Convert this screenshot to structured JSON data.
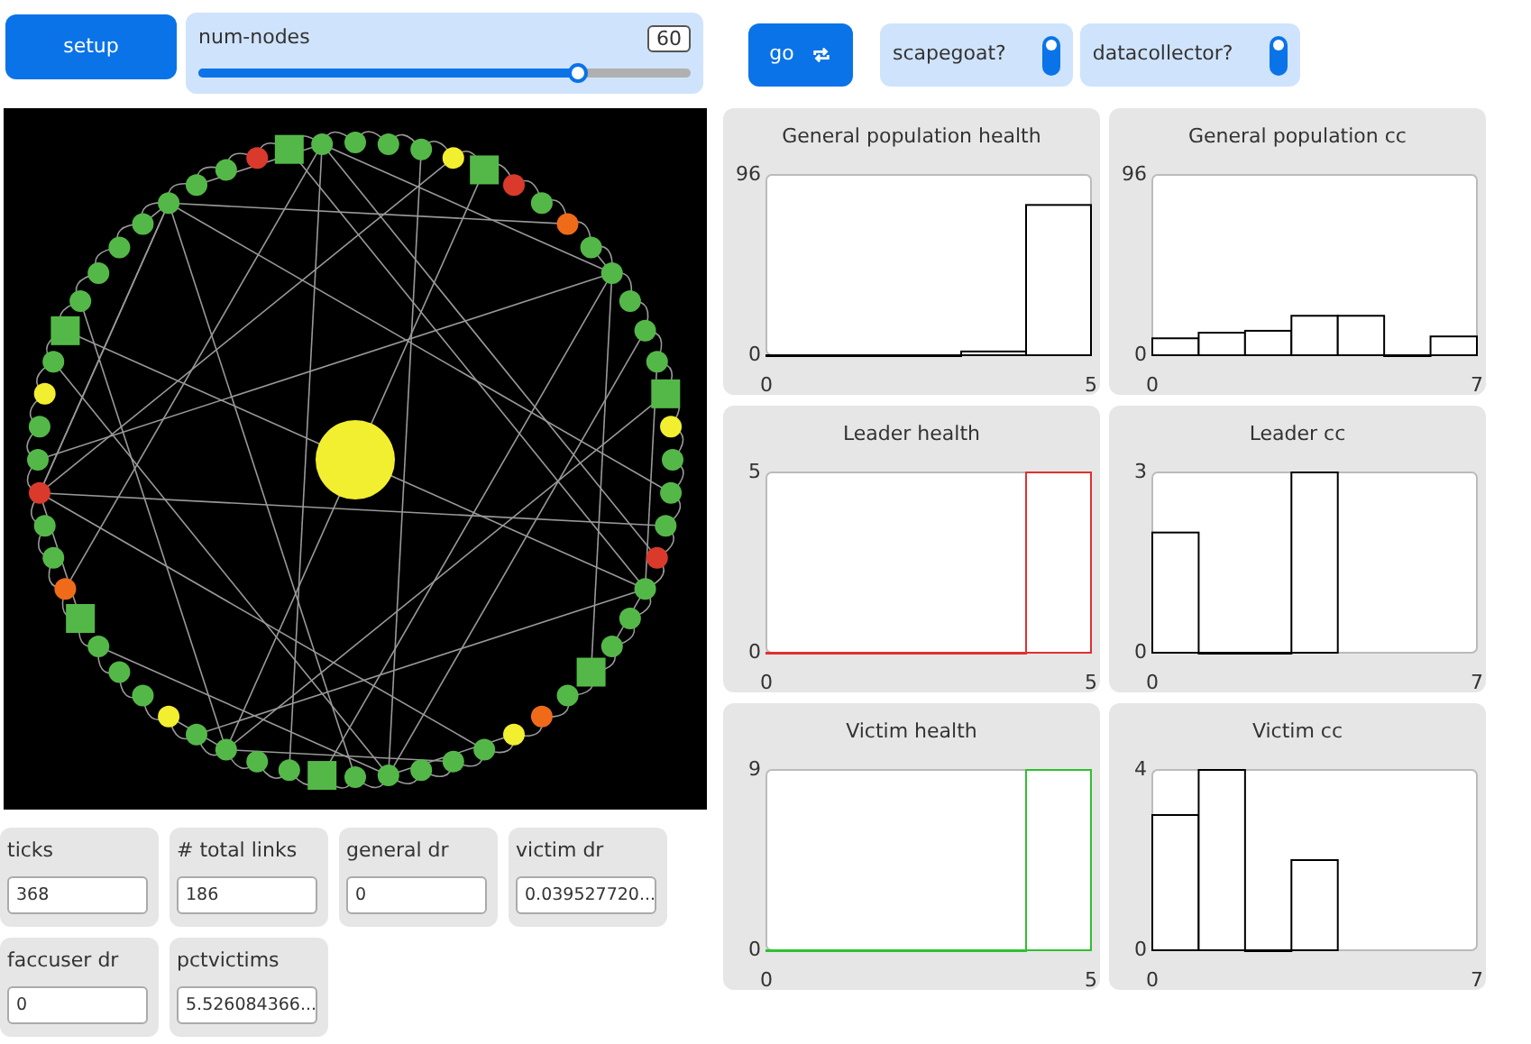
{
  "setup_button": {
    "label": "setup"
  },
  "slider": {
    "label": "num-nodes",
    "value": "60",
    "level": 0.77
  },
  "go_button": {
    "label": "go",
    "forever": true
  },
  "switches": [
    {
      "label": "scapegoat?",
      "on": true
    },
    {
      "label": "datacollector?",
      "on": true
    }
  ],
  "plots": [
    {
      "chart_data": {
        "type": "bar",
        "title": "General population health",
        "xlim": [
          0,
          5
        ],
        "ylim": [
          0,
          96
        ],
        "xticks": [
          0,
          5
        ],
        "yticks": [
          0,
          96
        ],
        "x": [
          0.5,
          1.5,
          2.5,
          3.5,
          4.5
        ],
        "series": [
          {
            "color": "#000000",
            "values": [
              0,
              0,
              0,
              2,
              80
            ]
          }
        ]
      }
    },
    {
      "chart_data": {
        "type": "bar",
        "title": "General population cc",
        "xlim": [
          0,
          7
        ],
        "ylim": [
          0,
          96
        ],
        "xticks": [
          0,
          7
        ],
        "yticks": [
          0,
          96
        ],
        "x": [
          0.5,
          1.5,
          2.5,
          3.5,
          4.5,
          5.5,
          6.5
        ],
        "series": [
          {
            "color": "#000000",
            "values": [
              9,
              12,
              13,
              21,
              21,
              0,
              10
            ]
          }
        ]
      }
    },
    {
      "chart_data": {
        "type": "bar",
        "title": "Leader health",
        "xlim": [
          0,
          5
        ],
        "ylim": [
          0,
          5
        ],
        "xticks": [
          0,
          5
        ],
        "yticks": [
          0,
          5
        ],
        "x": [
          0.5,
          1.5,
          2.5,
          3.5,
          4.5
        ],
        "series": [
          {
            "color": "#e03030",
            "values": [
              0,
              0,
              0,
              0,
              5
            ]
          }
        ]
      }
    },
    {
      "chart_data": {
        "type": "bar",
        "title": "Leader cc",
        "xlim": [
          0,
          7
        ],
        "ylim": [
          0,
          3
        ],
        "xticks": [
          0,
          7
        ],
        "yticks": [
          0,
          3
        ],
        "x": [
          0.5,
          1.5,
          2.5,
          3.5
        ],
        "series": [
          {
            "color": "#000000",
            "values": [
              2,
              0,
              0,
              3
            ]
          }
        ]
      }
    },
    {
      "chart_data": {
        "type": "bar",
        "title": "Victim health",
        "xlim": [
          0,
          5
        ],
        "ylim": [
          0,
          9
        ],
        "xticks": [
          0,
          5
        ],
        "yticks": [
          0,
          9
        ],
        "x": [
          0.5,
          1.5,
          2.5,
          3.5,
          4.5
        ],
        "series": [
          {
            "color": "#30c030",
            "values": [
              0,
              0,
              0,
              0,
              9
            ]
          }
        ]
      }
    },
    {
      "chart_data": {
        "type": "bar",
        "title": "Victim cc",
        "xlim": [
          0,
          7
        ],
        "ylim": [
          0,
          4
        ],
        "xticks": [
          0,
          7
        ],
        "yticks": [
          0,
          4
        ],
        "x": [
          0.5,
          1.5,
          2.5,
          3.5
        ],
        "series": [
          {
            "color": "#000000",
            "values": [
              3,
              4,
              0,
              2
            ]
          }
        ]
      }
    }
  ],
  "monitors": [
    {
      "label": "ticks",
      "value": "368"
    },
    {
      "label": "# total links",
      "value": "186"
    },
    {
      "label": "general dr",
      "value": "0"
    },
    {
      "label": "victim dr",
      "value": "0.039527720..."
    },
    {
      "label": "faccuser dr",
      "value": "0"
    },
    {
      "label": "pctvictims",
      "value": "5.526084366..."
    }
  ]
}
